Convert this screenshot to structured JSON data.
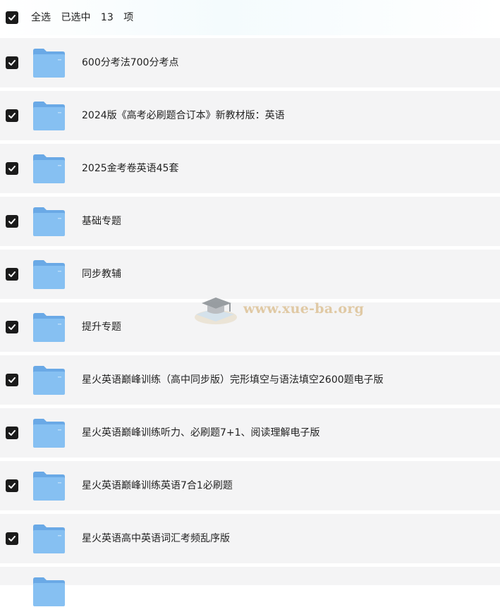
{
  "header": {
    "select_all_label": "全选",
    "selected_prefix": "已选中",
    "selected_count": "13",
    "selected_unit": "项"
  },
  "items": [
    {
      "name": "600分考法700分考点"
    },
    {
      "name": "2024版《高考必刷题合订本》新教材版：英语"
    },
    {
      "name": "2025金考卷英语45套"
    },
    {
      "name": "基础专题"
    },
    {
      "name": "同步教辅"
    },
    {
      "name": "提升专题"
    },
    {
      "name": "星火英语巅峰训练（高中同步版）完形填空与语法填空2600题电子版"
    },
    {
      "name": "星火英语巅峰训练听力、必刷题7+1、阅读理解电子版"
    },
    {
      "name": "星火英语巅峰训练英语7合1必刷题"
    },
    {
      "name": "星火英语高中英语词汇考频乱序版"
    }
  ],
  "watermark": {
    "text": "www.xue-ba.org"
  },
  "colors": {
    "checkbox": "#1b1b1b",
    "row_bg": "#f4f4f5",
    "folder": "#7db8ee"
  }
}
